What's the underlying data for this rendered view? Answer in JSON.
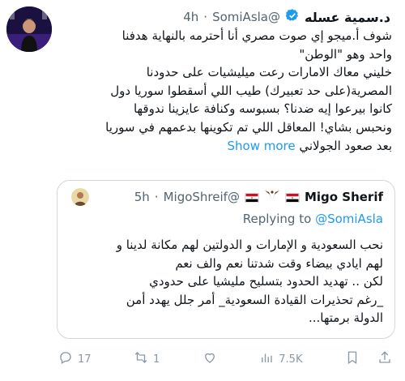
{
  "tweet": {
    "display_name": "د.سمية عسله",
    "handle": "@SomiAsla",
    "separator": "·",
    "timestamp": "4h",
    "lines": [
      "شوف أ.ميجو إي صوت مصري أنا أحترمه بالنهاية هدفنا",
      "واحد وهو \"الوطن\"",
      "خليني معاك الامارات رعت ميليشيات على حدودنا",
      "المصرية(على حد تعبيرك) طيب اللي أسقطوا سوريا دول",
      "كانوا بيرعوا إيه ضدنا؟ بسبوسه وكنافة عايزينا ندوقها",
      "ونحبس بشاي! المعاقل اللي تم تكوينها بدعمهم في سوريا",
      "بعد صعود الجولاني"
    ],
    "show_more": "Show more"
  },
  "quote": {
    "name": "Migo Sherif",
    "handle": "@MigoShreif",
    "separator": "·",
    "timestamp": "5h",
    "replying_prefix": "Replying to",
    "replying_to": "@SomiAsla",
    "lines": [
      "نحب السعودية و الإمارات و الدولتين لهم مكانة لدينا و",
      "لهم ايادي بيضاء وقت شدتنا نعم والف نعم",
      "لكن ..  تهديد الحدود بتسليح مليشيا على حدودي",
      "_رغم تحذيرات القيادة السعودية_ أمر جلل يهدد أمن",
      "الدولة برمتها..."
    ]
  },
  "actions": {
    "replies": "17",
    "reposts": "1",
    "views": "7.5K"
  },
  "icons": {
    "verified": "verified-badge-icon",
    "grok": "grok-icon",
    "reply": "reply-icon",
    "repost": "repost-icon",
    "like": "like-icon",
    "views": "views-icon",
    "bookmark": "bookmark-icon",
    "share": "share-icon"
  },
  "colors": {
    "link": "#1d9bf0",
    "verified": "#1d9bf0",
    "muted": "#536471",
    "border": "#cfd9de"
  }
}
